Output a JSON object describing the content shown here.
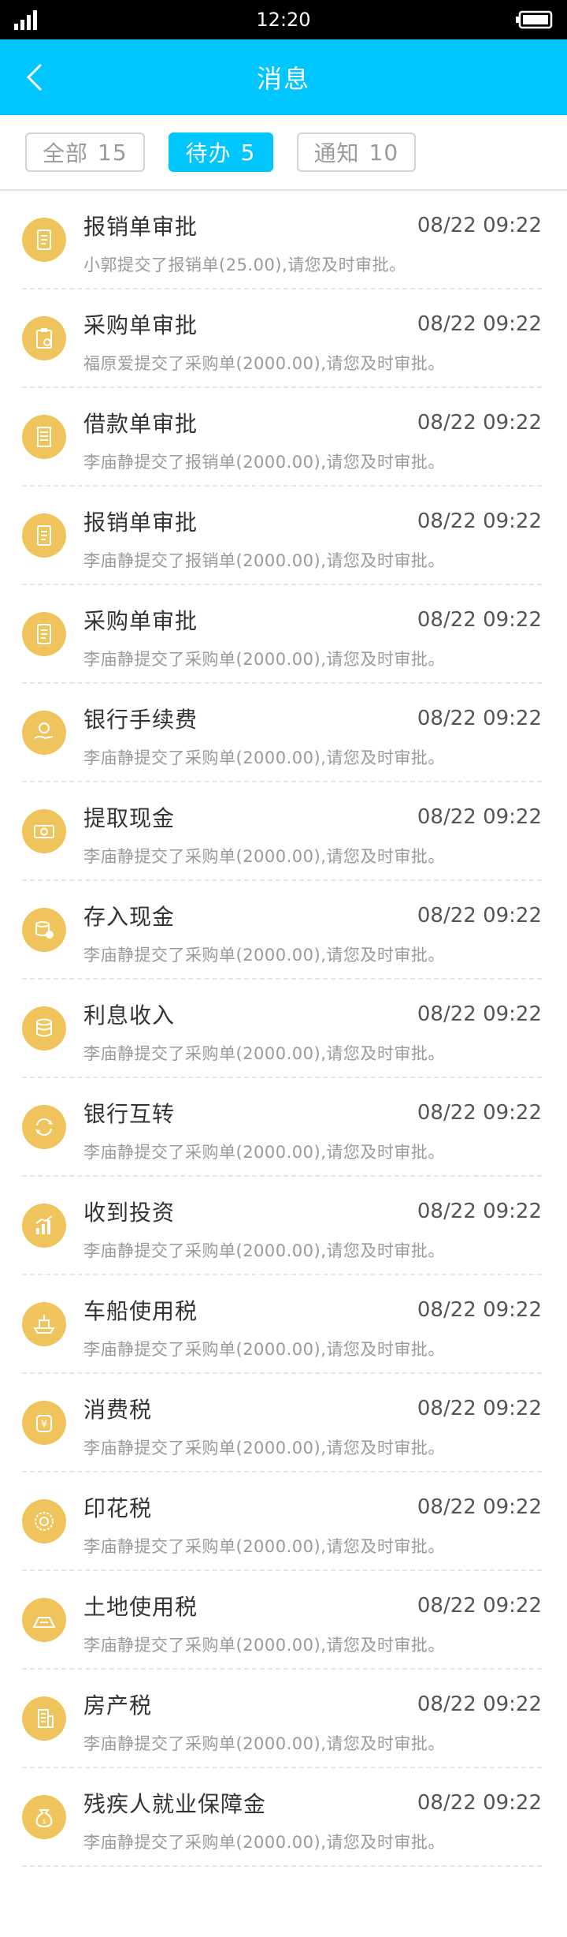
{
  "status": {
    "time": "12:20",
    "signal_icon": "signal-icon",
    "battery_icon": "battery-icon"
  },
  "header": {
    "title": "消息",
    "back_icon": "chevron-left-icon",
    "bg": "#00c6ff"
  },
  "tabs": [
    {
      "label": "全部",
      "count": "15",
      "active": false
    },
    {
      "label": "待办",
      "count": "5",
      "active": true
    },
    {
      "label": "通知",
      "count": "10",
      "active": false
    }
  ],
  "messages": [
    {
      "title": "报销单审批",
      "time": "08/22 09:22",
      "desc": "小郭提交了报销单(25.00),请您及时审批。",
      "icon": "receipt-icon"
    },
    {
      "title": "采购单审批",
      "time": "08/22 09:22",
      "desc": "福原爱提交了采购单(2000.00),请您及时审批。",
      "icon": "clipboard-icon"
    },
    {
      "title": "借款单审批",
      "time": "08/22 09:22",
      "desc": "李庙静提交了报销单(2000.00),请您及时审批。",
      "icon": "document-icon"
    },
    {
      "title": "报销单审批",
      "time": "08/22 09:22",
      "desc": "李庙静提交了报销单(2000.00),请您及时审批。",
      "icon": "receipt-icon"
    },
    {
      "title": "采购单审批",
      "time": "08/22 09:22",
      "desc": "李庙静提交了采购单(2000.00),请您及时审批。",
      "icon": "receipt-icon"
    },
    {
      "title": "银行手续费",
      "time": "08/22 09:22",
      "desc": "李庙静提交了采购单(2000.00),请您及时审批。",
      "icon": "hand-coin-icon"
    },
    {
      "title": "提取现金",
      "time": "08/22 09:22",
      "desc": "李庙静提交了采购单(2000.00),请您及时审批。",
      "icon": "cash-icon"
    },
    {
      "title": "存入现金",
      "time": "08/22 09:22",
      "desc": "李庙静提交了采购单(2000.00),请您及时审批。",
      "icon": "coin-stack-icon"
    },
    {
      "title": "利息收入",
      "time": "08/22 09:22",
      "desc": "李庙静提交了采购单(2000.00),请您及时审批。",
      "icon": "coins-icon"
    },
    {
      "title": "银行互转",
      "time": "08/22 09:22",
      "desc": "李庙静提交了采购单(2000.00),请您及时审批。",
      "icon": "transfer-icon"
    },
    {
      "title": "收到投资",
      "time": "08/22 09:22",
      "desc": "李庙静提交了采购单(2000.00),请您及时审批。",
      "icon": "growth-chart-icon"
    },
    {
      "title": "车船使用税",
      "time": "08/22 09:22",
      "desc": "李庙静提交了采购单(2000.00),请您及时审批。",
      "icon": "ship-icon"
    },
    {
      "title": "消费税",
      "time": "08/22 09:22",
      "desc": "李庙静提交了采购单(2000.00),请您及时审批。",
      "icon": "yen-bag-icon"
    },
    {
      "title": "印花税",
      "time": "08/22 09:22",
      "desc": "李庙静提交了采购单(2000.00),请您及时审批。",
      "icon": "stamp-icon"
    },
    {
      "title": "土地使用税",
      "time": "08/22 09:22",
      "desc": "李庙静提交了采购单(2000.00),请您及时审批。",
      "icon": "land-icon"
    },
    {
      "title": "房产税",
      "time": "08/22 09:22",
      "desc": "李庙静提交了采购单(2000.00),请您及时审批。",
      "icon": "building-icon"
    },
    {
      "title": "残疾人就业保障金",
      "time": "08/22 09:22",
      "desc": "李庙静提交了采购单(2000.00),请您及时审批。",
      "icon": "money-bag-icon"
    }
  ]
}
